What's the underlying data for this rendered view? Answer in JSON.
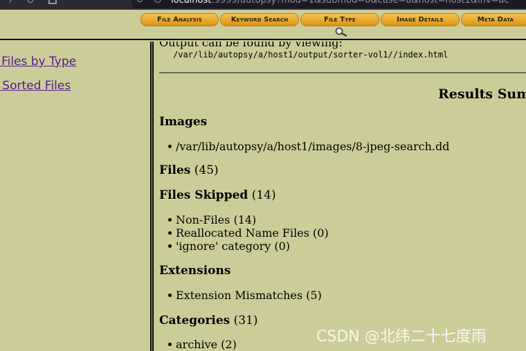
{
  "browser": {
    "url_host": "localhost",
    "url_rest": ":9999/autopsy?mod=1&submod=0&case=a&host=host1&inv=ac"
  },
  "tabs": [
    {
      "label": "File Analysis"
    },
    {
      "label": "Keyword Search"
    },
    {
      "label": "File Type"
    },
    {
      "label": "Image Details"
    },
    {
      "label": "Meta Data"
    }
  ],
  "sidebar": {
    "links": [
      {
        "label": "t Files by Type"
      },
      {
        "label": "w Sorted Files"
      }
    ]
  },
  "content": {
    "partial_heading": "Output can be found by viewing:",
    "output_path": "/var/lib/autopsy/a/host1/output/sorter-vol1//index.html",
    "results_title": "Results Summary",
    "images": {
      "label": "Images",
      "items": [
        "/var/lib/autopsy/a/host1/images/8-jpeg-search.dd"
      ]
    },
    "files": {
      "label": "Files",
      "count": "(45)"
    },
    "files_skipped": {
      "label": "Files Skipped",
      "count": "(14)",
      "items": [
        "Non-Files (14)",
        "Reallocated Name Files (0)",
        "'ignore' category (0)"
      ]
    },
    "extensions": {
      "label": "Extensions",
      "items": [
        "Extension Mismatches (5)"
      ]
    },
    "categories": {
      "label": "Categories",
      "count": "(31)",
      "items": [
        "archive (2)"
      ]
    }
  },
  "watermark": "CSDN @北纬二十七度雨"
}
